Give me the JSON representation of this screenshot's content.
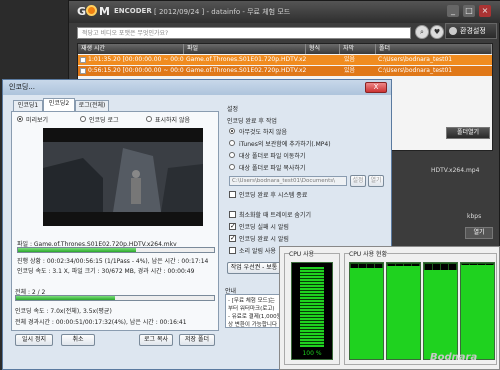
{
  "gom": {
    "logo_g": "G",
    "logo_m": "M",
    "logo_encoder": "ENCODER",
    "version": "[ 2012/09/24 ] - datainfo - 무료 체험 모드",
    "search_placeholder": "적당고 비디오 포맷은 무엇인가요?",
    "settings_label": "환경설정",
    "columns": [
      "재생 시간",
      "파일",
      "형식",
      "자막",
      "폴더"
    ],
    "rows": [
      {
        "time": "1:01:35.20 [00:00:00.00 ~ 00:00:00.00]",
        "file": "Game.of.Thrones.S01E01.720p.HDTV.x264.MKV",
        "format": "",
        "sub": "있음",
        "folder": "C:\\Users\\bodnara_test01"
      },
      {
        "time": "0:56:15.20 [00:00:00.00 ~ 00:00:00.00]",
        "file": "Game.of.Thrones.S01E02.720p.HDTV.x264.MKV",
        "format": "",
        "sub": "있음",
        "folder": "C:\\Users\\bodnara_test01"
      }
    ],
    "footer_button": "폴더열기",
    "side_file": "HDTV.x264.mp4",
    "side_bitrate": "kbps",
    "side_btn": "열기"
  },
  "dialog": {
    "title": "인코딩...",
    "close": "X",
    "tabs": [
      "인코딩1",
      "인코딩2",
      "로그(전체)"
    ],
    "preview_options": [
      "미리보기",
      "인코딩 로그",
      "표시하지 않음"
    ],
    "filename": "파일 : Game.of.Thrones.S01E02.720p.HDTV.x264.mkv",
    "file_progress": 0.6,
    "stat1": "진행 상황 : 00:02:34/00:56:15 (1/1Pass - 4%), 남은 시간 : 00:17:14",
    "stat2": "인코딩 속도 : 3.1 X, 파일 크기 : 30/672 MB, 경과 시간 : 00:00:49",
    "total_label": "전체 : 2 / 2",
    "total_progress": 0.5,
    "stat3": "인코딩 속도 : 7.0x(전체), 3.5x(평균)",
    "stat4": "전체 경과시간 : 00:00:51/00:17:32(4%), 남은 시간 : 00:16:41",
    "buttons": [
      "일시 정지",
      "취소",
      "로그 복사",
      "저장 폴더"
    ],
    "settings_title": "설정",
    "after_label": "인코딩 완료 후 작업",
    "after_options": [
      "아무것도 하지 않음",
      "iTunes의 보관함에 추가하기(.MP4)",
      "대상 폴더로 파일 이동하기",
      "대상 폴더로 파일 복사하기"
    ],
    "path": "C:\\Users\\bodnara_test01\\Documents\\",
    "path_btn1": "설정",
    "path_btn2": "열기",
    "shutdown": "인코딩 완료 후 시스템 종료",
    "minimize_tray": "최소화할 때 트레이로 숨기기",
    "notify_fail": "인코딩 실패 시 알림",
    "notify_done": "인코딩 완료 시 알림",
    "sound": "소리 알림 사용",
    "priority": "작업 우선권 - 보통",
    "notice_title": "안내",
    "notice1": "- [무료 체험 모드]는",
    "notice2": "부터 워터마크(로고)",
    "notice3": "- 유료로 결제(1,000원",
    "notice4": "상 변환이 가능합니다"
  },
  "cpu": {
    "usage_title": "CPU 사용",
    "usage_value": "100 %",
    "usage_level": 1.0,
    "history_title": "CPU 사용 현황",
    "core_levels": [
      0.95,
      0.97,
      0.93,
      0.98
    ]
  },
  "watermark": "Bodnara",
  "colors": {
    "accent": "#f08c20",
    "progress": "#2aa82a",
    "cpu_graph": "#1fd21f"
  }
}
